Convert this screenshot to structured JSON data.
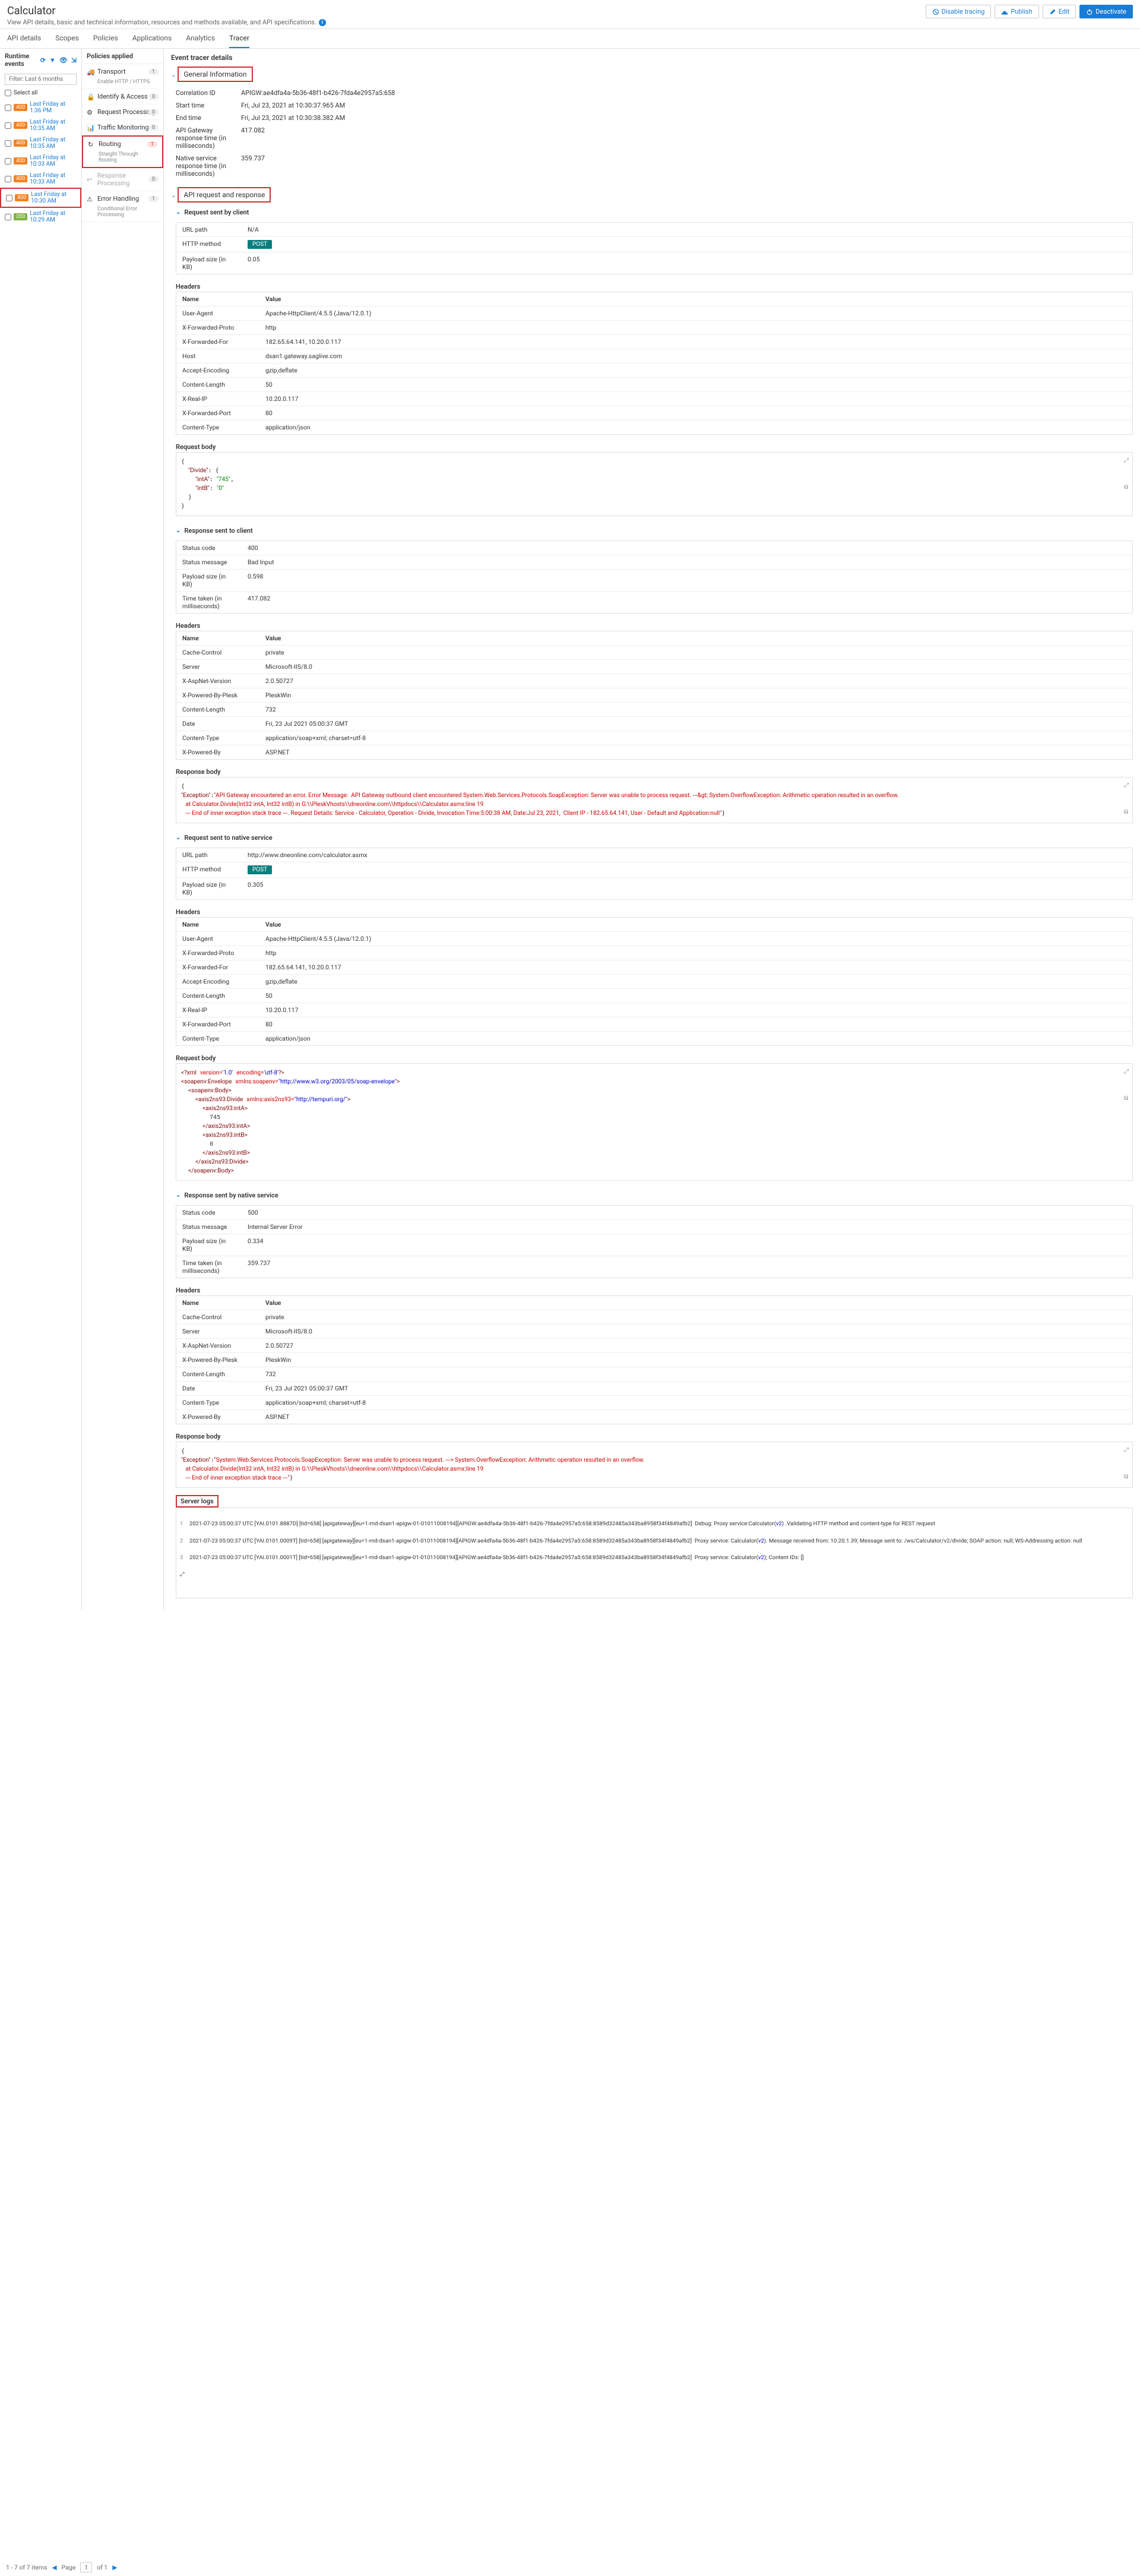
{
  "header": {
    "title": "Calculator",
    "subtitle": "View API details, basic and technical information, resources and methods available, and API specifications.",
    "actions": {
      "disable_tracing": "Disable tracing",
      "publish": "Publish",
      "edit": "Edit",
      "deactivate": "Deactivate"
    }
  },
  "tabs": [
    "API details",
    "Scopes",
    "Policies",
    "Applications",
    "Analytics",
    "Tracer"
  ],
  "active_tab": "Tracer",
  "runtime": {
    "title": "Runtime events",
    "filter": "Filter: Last 6 months",
    "select_all": "Select all",
    "events": [
      {
        "code": "400",
        "time": "Last Friday at 1:36 PM"
      },
      {
        "code": "400",
        "time": "Last Friday at 10:35 AM"
      },
      {
        "code": "400",
        "time": "Last Friday at 10:35 AM"
      },
      {
        "code": "400",
        "time": "Last Friday at 10:33 AM"
      },
      {
        "code": "400",
        "time": "Last Friday at 10:33 AM"
      },
      {
        "code": "400",
        "time": "Last Friday at 10:30 AM",
        "selected": true
      },
      {
        "code": "200",
        "time": "Last Friday at 10:29 AM"
      }
    ]
  },
  "policies": {
    "title": "Policies applied",
    "items": [
      {
        "icon": "truck",
        "label": "Transport",
        "sub": "Enable HTTP / HTTPS",
        "count": "1"
      },
      {
        "icon": "lock",
        "label": "Identify & Access",
        "count": "0"
      },
      {
        "icon": "gear",
        "label": "Request Processing",
        "count": "0"
      },
      {
        "icon": "bars",
        "label": "Traffic Monitoring",
        "count": "0"
      },
      {
        "icon": "refresh",
        "label": "Routing",
        "sub": "Straight Through Routing",
        "count": "1",
        "hl": true
      },
      {
        "icon": "reply",
        "label": "Response Processing",
        "dim": true,
        "count": "0"
      },
      {
        "icon": "warn",
        "label": "Error Handling",
        "sub": "Conditional Error Processing",
        "count": "1"
      }
    ]
  },
  "tracer": {
    "title": "Event tracer details",
    "general": {
      "title": "General Information",
      "rows": [
        {
          "k": "Correlation ID",
          "v": "APIGW:ae4dfa4a-5b36-48f1-b426-7fda4e2957a5:658"
        },
        {
          "k": "Start time",
          "v": "Fri, Jul 23, 2021 at 10:30:37.965 AM"
        },
        {
          "k": "End time",
          "v": "Fri, Jul 23, 2021 at 10:30:38.382 AM"
        },
        {
          "k": "API Gateway response time (in milliseconds)",
          "v": "417.082"
        },
        {
          "k": "Native service response time (in milliseconds)",
          "v": "359.737"
        }
      ]
    },
    "api_rr": {
      "title": "API request and response"
    },
    "req_client": {
      "title": "Request sent by client",
      "rows": [
        {
          "k": "URL path",
          "v": "N/A"
        },
        {
          "k": "HTTP method",
          "v": "POST",
          "badge": true
        },
        {
          "k": "Payload size (in KB)",
          "v": "0.05"
        }
      ],
      "headers_label": "Headers",
      "th_name": "Name",
      "th_value": "Value",
      "headers": [
        {
          "n": "User-Agent",
          "v": "Apache-HttpClient/4.5.5 (Java/12.0.1)"
        },
        {
          "n": "X-Forwarded-Proto",
          "v": "http"
        },
        {
          "n": "X-Forwarded-For",
          "v": "182.65.64.141, 10.20.0.117"
        },
        {
          "n": "Host",
          "v": "dsan1.gateway.saglive.com"
        },
        {
          "n": "Accept-Encoding",
          "v": "gzip,deflate"
        },
        {
          "n": "Content-Length",
          "v": "50"
        },
        {
          "n": "X-Real-IP",
          "v": "10.20.0.117"
        },
        {
          "n": "X-Forwarded-Port",
          "v": "80"
        },
        {
          "n": "Content-Type",
          "v": "application/json"
        }
      ],
      "body_label": "Request body"
    },
    "resp_client": {
      "title": "Response sent to client",
      "rows": [
        {
          "k": "Status code",
          "v": "400"
        },
        {
          "k": "Status message",
          "v": "Bad Input"
        },
        {
          "k": "Payload size (in KB)",
          "v": "0.598"
        },
        {
          "k": "Time taken (in milliseconds)",
          "v": "417.082"
        }
      ],
      "headers_label": "Headers",
      "th_name": "Name",
      "th_value": "Value",
      "headers": [
        {
          "n": "Cache-Control",
          "v": "private"
        },
        {
          "n": "Server",
          "v": "Microsoft-IIS/8.0"
        },
        {
          "n": "X-AspNet-Version",
          "v": "2.0.50727"
        },
        {
          "n": "X-Powered-By-Plesk",
          "v": "PleskWin"
        },
        {
          "n": "Content-Length",
          "v": "732"
        },
        {
          "n": "Date",
          "v": "Fri, 23 Jul 2021 05:00:37 GMT"
        },
        {
          "n": "Content-Type",
          "v": "application/soap+xml; charset=utf-8"
        },
        {
          "n": "X-Powered-By",
          "v": "ASP.NET"
        }
      ],
      "body_label": "Response body"
    },
    "req_native": {
      "title": "Request sent to native service",
      "rows": [
        {
          "k": "URL path",
          "v": "http://www.dneonline.com/calculator.asmx"
        },
        {
          "k": "HTTP method",
          "v": "POST",
          "badge": true
        },
        {
          "k": "Payload size (in KB)",
          "v": "0.305"
        }
      ],
      "headers_label": "Headers",
      "th_name": "Name",
      "th_value": "Value",
      "headers": [
        {
          "n": "User-Agent",
          "v": "Apache-HttpClient/4.5.5 (Java/12.0.1)"
        },
        {
          "n": "X-Forwarded-Proto",
          "v": "http"
        },
        {
          "n": "X-Forwarded-For",
          "v": "182.65.64.141, 10.20.0.117"
        },
        {
          "n": "Accept-Encoding",
          "v": "gzip,deflate"
        },
        {
          "n": "Content-Length",
          "v": "50"
        },
        {
          "n": "X-Real-IP",
          "v": "10.20.0.117"
        },
        {
          "n": "X-Forwarded-Port",
          "v": "80"
        },
        {
          "n": "Content-Type",
          "v": "application/json"
        }
      ],
      "body_label": "Request body"
    },
    "resp_native": {
      "title": "Response sent by native service",
      "rows": [
        {
          "k": "Status code",
          "v": "500"
        },
        {
          "k": "Status message",
          "v": "Internal Server Error"
        },
        {
          "k": "Payload size (in KB)",
          "v": "0.334"
        },
        {
          "k": "Time taken (in milliseconds)",
          "v": "359.737"
        }
      ],
      "headers_label": "Headers",
      "th_name": "Name",
      "th_value": "Value",
      "headers": [
        {
          "n": "Cache-Control",
          "v": "private"
        },
        {
          "n": "Server",
          "v": "Microsoft-IIS/8.0"
        },
        {
          "n": "X-AspNet-Version",
          "v": "2.0.50727"
        },
        {
          "n": "X-Powered-By-Plesk",
          "v": "PleskWin"
        },
        {
          "n": "Content-Length",
          "v": "732"
        },
        {
          "n": "Date",
          "v": "Fri, 23 Jul 2021 05:00:37 GMT"
        },
        {
          "n": "Content-Type",
          "v": "application/soap+xml; charset=utf-8"
        },
        {
          "n": "X-Powered-By",
          "v": "ASP.NET"
        }
      ],
      "body_label": "Response body"
    },
    "server_logs": {
      "title": "Server logs"
    }
  },
  "footer": {
    "items": "1 - 7 of 7 items",
    "page": "Page",
    "pagenum": "1",
    "of": "of 1"
  }
}
